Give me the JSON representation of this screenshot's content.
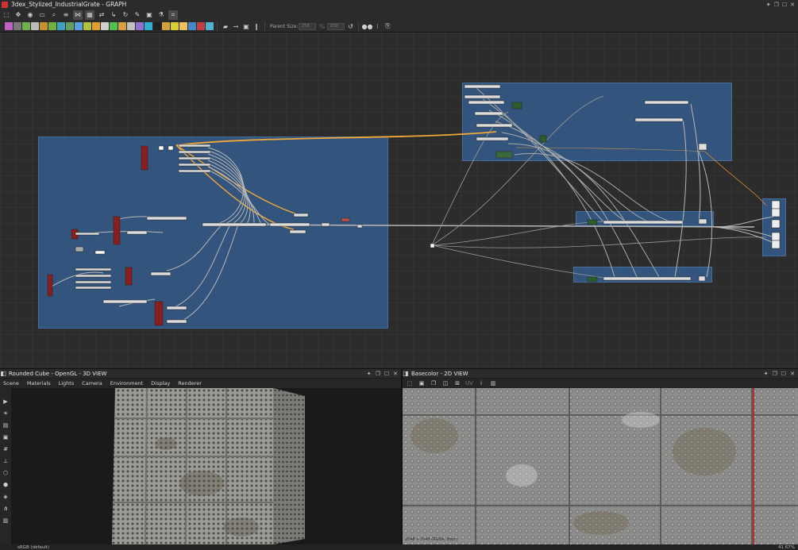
{
  "window": {
    "title": "3dex_Stylized_IndustrialGrate - GRAPH",
    "controls": [
      "pin-icon",
      "restore-icon",
      "maximize-icon",
      "close-icon"
    ]
  },
  "toolbar_top": {
    "icons": [
      "select-icon",
      "pan-icon",
      "camera-icon",
      "frame-icon",
      "zoom-icon",
      "layout-icon",
      "grid-icon",
      "link-icon",
      "wire-icon",
      "cycle-icon",
      "tool-icon",
      "pin-icon",
      "flask-icon",
      "crop-icon"
    ]
  },
  "toolbar_nodes": {
    "parent_size_label": "Parent Size:",
    "parent_size_width": "256",
    "parent_size_height": "256",
    "colors": [
      "#c060c0",
      "#7a7a7a",
      "#6fb04c",
      "#bbbbbb",
      "#c89030",
      "#70b040",
      "#40a0c0",
      "#60a060",
      "#5aa0e0",
      "#b0c040",
      "#e0a030",
      "#d0d0d0",
      "#50c050",
      "#d8a040",
      "#c0c0c0",
      "#9070d0",
      "#30b0d0",
      "#202020",
      "#d4a040",
      "#d8d030",
      "#f0c060",
      "#4488cc",
      "#c04040",
      "#50b0d0"
    ]
  },
  "graph": {
    "frames": 6
  },
  "panel_3d": {
    "title": "Rounded Cube - OpenGL - 3D VIEW",
    "menu": [
      "Scene",
      "Materials",
      "Lights",
      "Camera",
      "Environment",
      "Display",
      "Renderer"
    ],
    "colorspace": "sRGB (default)"
  },
  "panel_2d": {
    "title": "Basecolor - 2D VIEW",
    "resolution": "2048 x 2048 (RGBA, 8bpc)",
    "zoom": "41.67%"
  }
}
